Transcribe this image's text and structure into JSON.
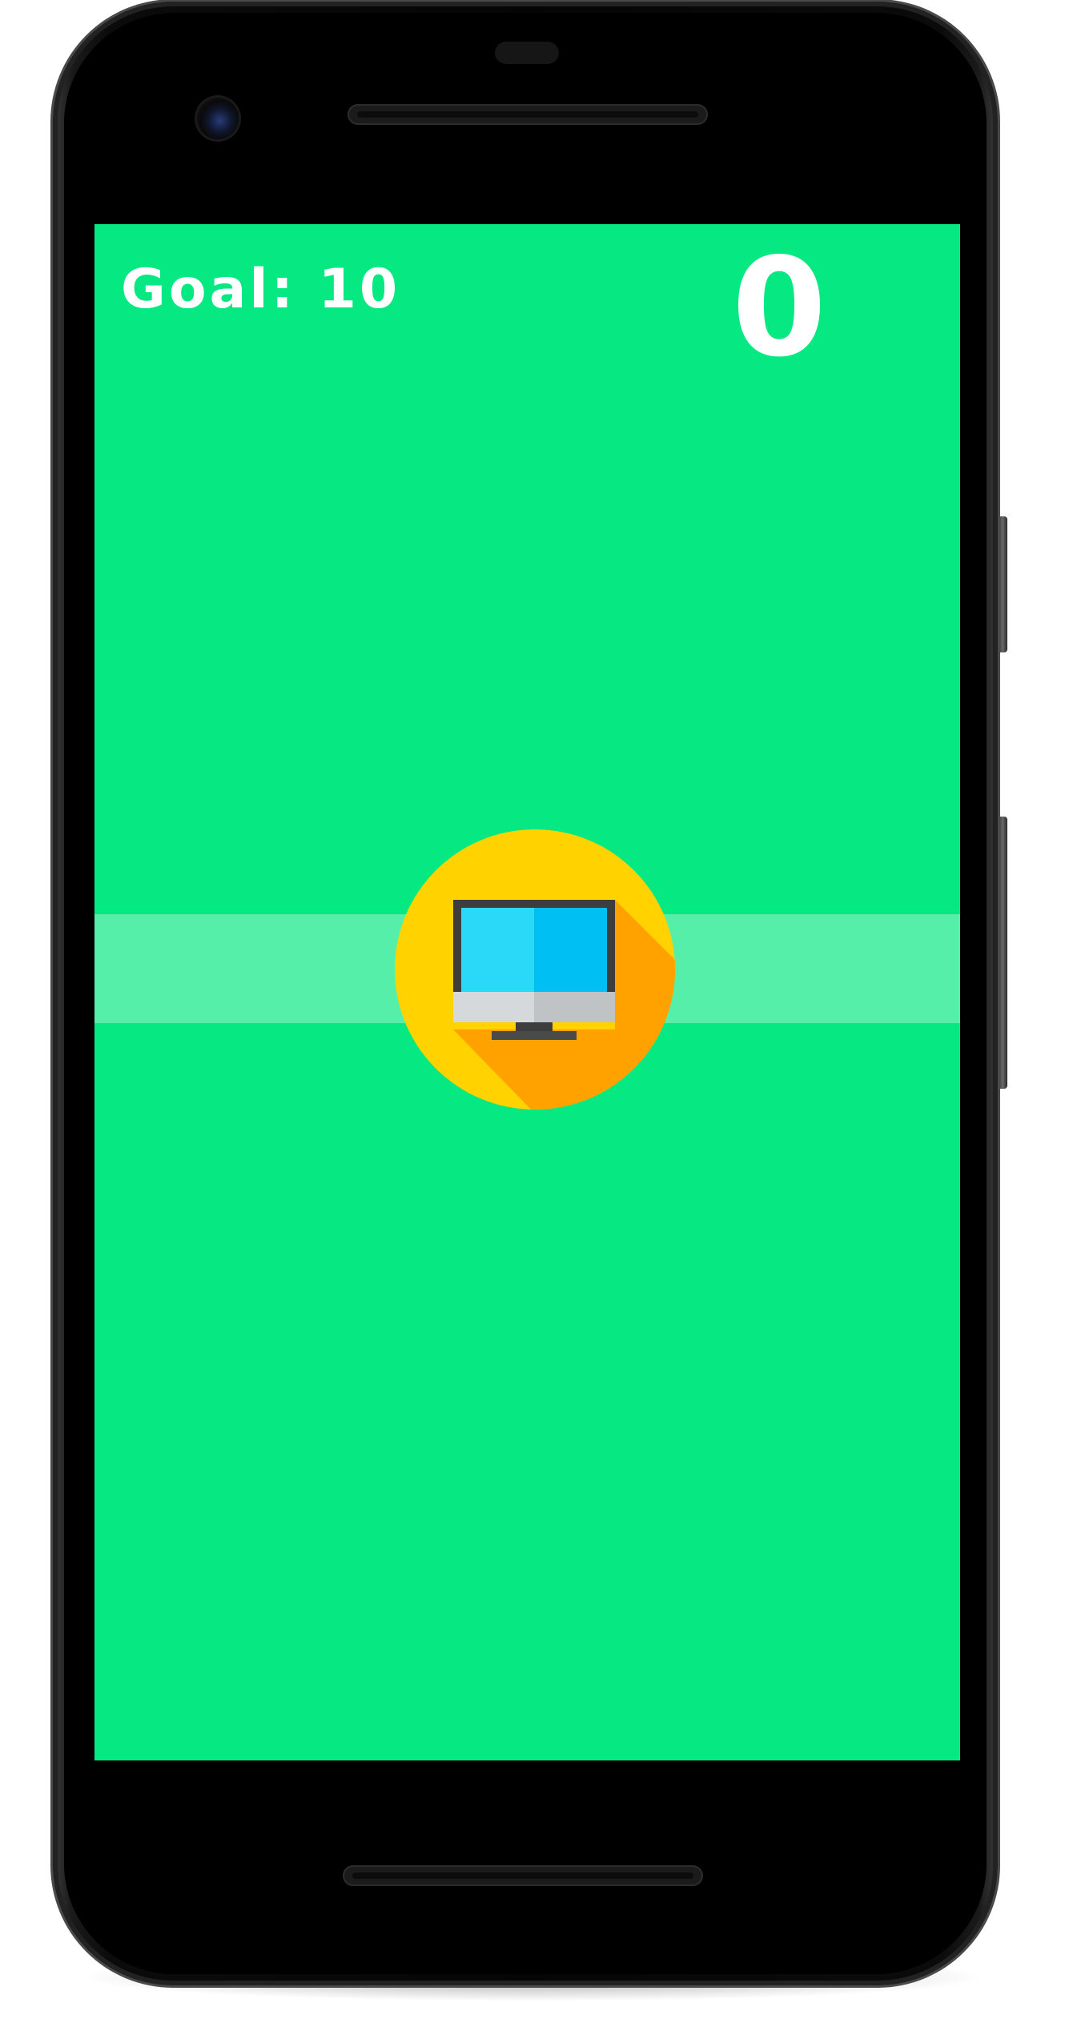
{
  "game": {
    "goal_label": "Goal: 10",
    "score": "0",
    "target_icon": "computer-monitor-icon"
  },
  "colors": {
    "background": "#06e882",
    "lane": "#52f0a8",
    "target_circle": "#ffd200",
    "target_shadow": "#ffa200",
    "screen_left": "#2ad9f8",
    "screen_right": "#00bff2",
    "monitor_frame": "#3d3d3d",
    "monitor_base": "#c5c9cc",
    "text": "#ffffff"
  }
}
